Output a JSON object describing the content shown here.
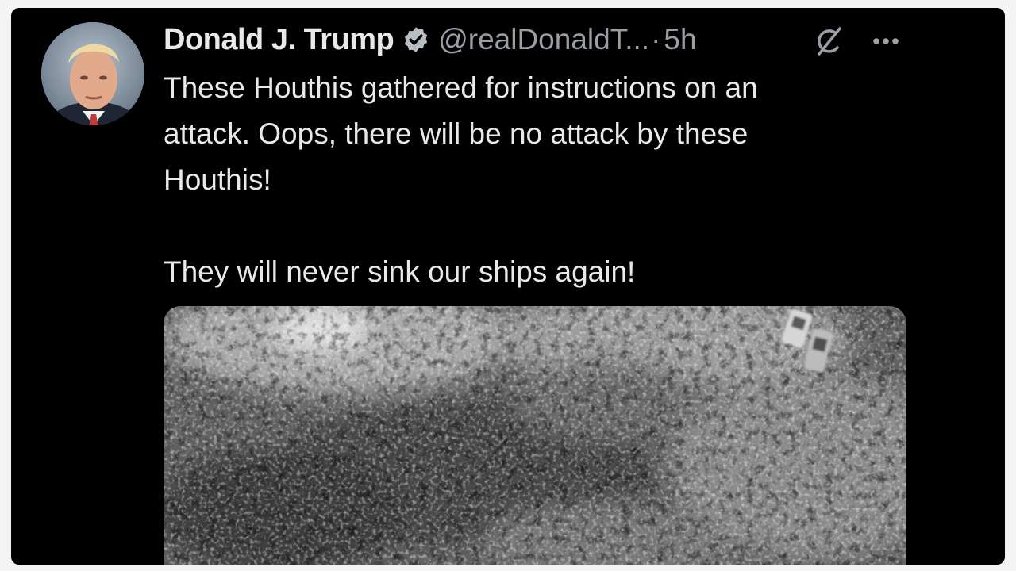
{
  "post": {
    "display_name": "Donald J. Trump",
    "handle": "@realDonaldT...",
    "separator": "·",
    "time": "5h",
    "text_lines": [
      "These Houthis gathered for instructions on an",
      "attack. Oops, there will be no attack by these",
      "Houthis!",
      "They will never sink our ships again!"
    ]
  },
  "icons": {
    "verified": "verified-badge-icon",
    "grok": "grok-icon",
    "more": "more-options-icon"
  },
  "colors": {
    "background": "#000000",
    "text": "#e7e9ea",
    "secondary_text": "#9a9fa4",
    "badge": "#b9bec4"
  }
}
